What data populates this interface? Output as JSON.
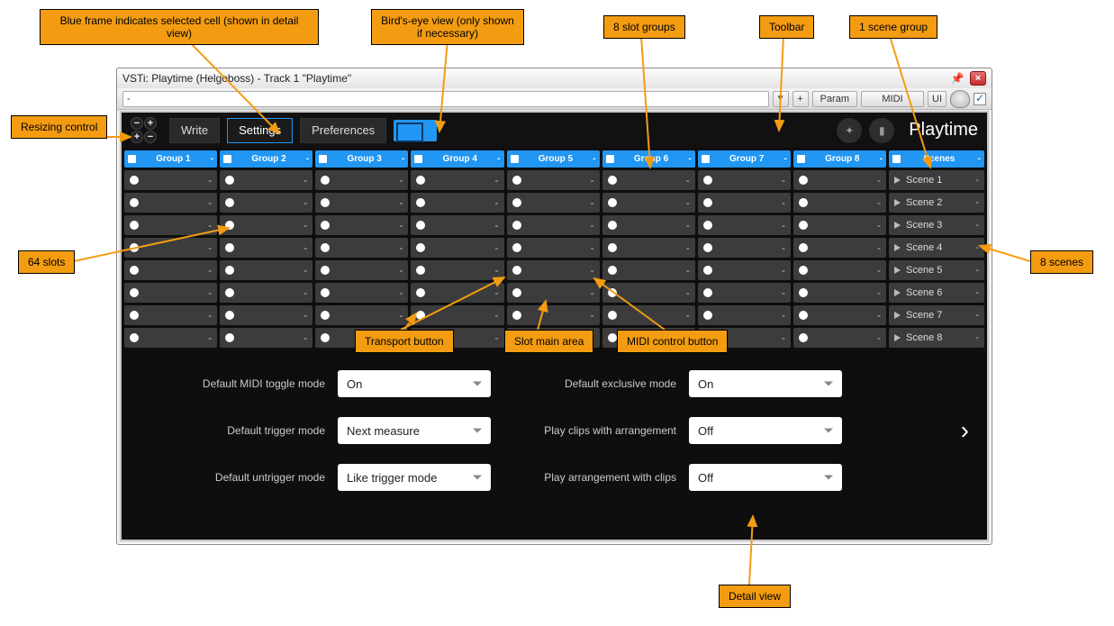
{
  "window": {
    "title": "VSTi: Playtime (Helgoboss) - Track 1 \"Playtime\""
  },
  "host": {
    "preset": "-",
    "plus": "+",
    "param": "Param",
    "midi": "MIDI",
    "ui": "UI"
  },
  "toolbar": {
    "write": "Write",
    "settings": "Settings",
    "preferences": "Preferences",
    "logo": "Playtime"
  },
  "groups": [
    {
      "label": "Group 1"
    },
    {
      "label": "Group 2"
    },
    {
      "label": "Group 3"
    },
    {
      "label": "Group 4"
    },
    {
      "label": "Group 5"
    },
    {
      "label": "Group 6"
    },
    {
      "label": "Group 7"
    },
    {
      "label": "Group 8"
    }
  ],
  "scenes_header": {
    "label": "Scenes"
  },
  "scenes": [
    {
      "label": "Scene 1"
    },
    {
      "label": "Scene 2"
    },
    {
      "label": "Scene 3"
    },
    {
      "label": "Scene 4"
    },
    {
      "label": "Scene 5"
    },
    {
      "label": "Scene 6"
    },
    {
      "label": "Scene 7"
    },
    {
      "label": "Scene 8"
    }
  ],
  "slot_dash": "-",
  "detail": {
    "l0": "Default MIDI toggle mode",
    "v0": "On",
    "l1": "Default exclusive mode",
    "v1": "On",
    "l2": "Default trigger mode",
    "v2": "Next measure",
    "l3": "Play clips with arrangement",
    "v3": "Off",
    "l4": "Default untrigger mode",
    "v4": "Like trigger mode",
    "l5": "Play arrangement with clips",
    "v5": "Off"
  },
  "callouts": {
    "selected": "Blue frame indicates selected cell (shown in detail view)",
    "birds": "Bird's-eye view (only shown if necessary)",
    "eight_groups": "8 slot groups",
    "toolbar": "Toolbar",
    "one_scene": "1 scene group",
    "resize": "Resizing control",
    "sixty": "64 slots",
    "eight_scenes": "8 scenes",
    "transport": "Transport button",
    "slotmain": "Slot main area",
    "midictl": "MIDI control button",
    "detail": "Detail view"
  }
}
